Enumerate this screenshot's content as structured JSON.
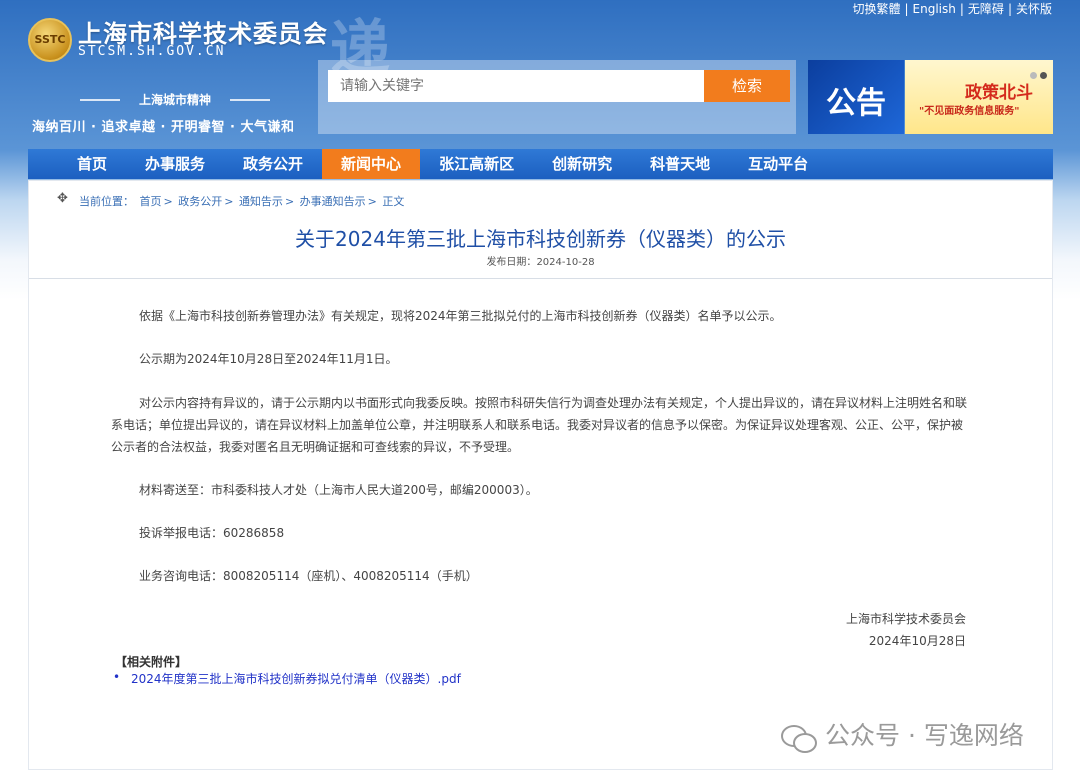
{
  "header": {
    "emblem_text": "SSTC",
    "site_title": "上海市科学技术委员会",
    "domain": "STCSM.SH.GOV.CN",
    "art_text": "递",
    "spirit_label": "上海城市精神",
    "spirit_motto": "海纳百川 · 追求卓越 · 开明睿智 · 大气谦和",
    "top_links": [
      "切换繁體",
      "English",
      "无障碍",
      "关怀版"
    ],
    "search": {
      "placeholder": "请输入关键字",
      "button": "检索"
    },
    "banner1_text": "公告",
    "banner2": {
      "title": "政策北斗",
      "subtitle": "\"不见面政务信息服务\""
    }
  },
  "nav": {
    "items": [
      "首页",
      "办事服务",
      "政务公开",
      "新闻中心",
      "张江高新区",
      "创新研究",
      "科普天地",
      "互动平台"
    ],
    "active_index": 3
  },
  "breadcrumb": {
    "label": "当前位置：",
    "items": [
      "首页",
      "政务公开",
      "通知告示",
      "办事通知告示",
      "正文"
    ],
    "separator": ">"
  },
  "article": {
    "title": "关于2024年第三批上海市科技创新券（仪器类）的公示",
    "date_label": "发布日期：",
    "date": "2024-10-28",
    "paragraphs": [
      "依据《上海市科技创新券管理办法》有关规定，现将2024年第三批拟兑付的上海市科技创新券（仪器类）名单予以公示。",
      "公示期为2024年10月28日至2024年11月1日。",
      "对公示内容持有异议的，请于公示期内以书面形式向我委反映。按照市科研失信行为调查处理办法有关规定，个人提出异议的，请在异议材料上注明姓名和联系电话；单位提出异议的，请在异议材料上加盖单位公章，并注明联系人和联系电话。我委对异议者的信息予以保密。为保证异议处理客观、公正、公平，保护被公示者的合法权益，我委对匿名且无明确证据和可查线索的异议，不予受理。",
      "材料寄送至：市科委科技人才处（上海市人民大道200号，邮编200003）。",
      "投诉举报电话：60286858",
      "业务咨询电话：8008205114（座机）、4008205114（手机）"
    ],
    "signature_org": "上海市科学技术委员会",
    "signature_date": "2024年10月28日",
    "attachments_heading": "【相关附件】",
    "attachments": [
      "2024年度第三批上海市科技创新券拟兑付清单（仪器类）.pdf"
    ]
  },
  "watermark": "公众号 · 写逸网络"
}
